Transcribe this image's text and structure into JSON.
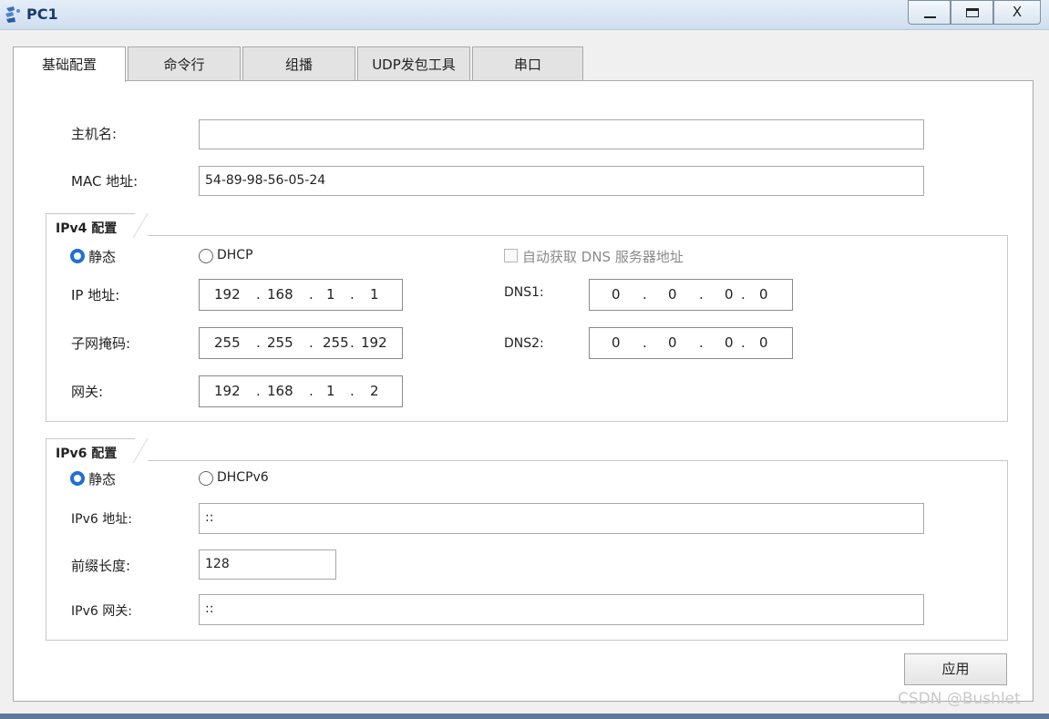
{
  "window": {
    "title": "PC1",
    "icon": "pc-app-icon",
    "controls": {
      "minimize": "minimize-icon",
      "maximize": "maximize-icon",
      "close": "X"
    }
  },
  "tabs": [
    {
      "label": "基础配置",
      "active": true
    },
    {
      "label": "命令行",
      "active": false
    },
    {
      "label": "组播",
      "active": false
    },
    {
      "label": "UDP发包工具",
      "active": false
    },
    {
      "label": "串口",
      "active": false
    }
  ],
  "basic": {
    "hostname_label": "主机名:",
    "hostname_value": "",
    "mac_label": "MAC 地址:",
    "mac_value": "54-89-98-56-05-24"
  },
  "ipv4": {
    "group_title": "IPv4 配置",
    "static_label": "静态",
    "dhcp_label": "DHCP",
    "mode": "static",
    "auto_dns_label": "自动获取 DNS 服务器地址",
    "auto_dns_checked": false,
    "ip_label": "IP 地址:",
    "ip": [
      "192",
      "168",
      "1",
      "1"
    ],
    "mask_label": "子网掩码:",
    "mask": [
      "255",
      "255",
      "255",
      "192"
    ],
    "gateway_label": "网关:",
    "gateway": [
      "192",
      "168",
      "1",
      "2"
    ],
    "dns1_label": "DNS1:",
    "dns1": [
      "0",
      "0",
      "0",
      "0"
    ],
    "dns2_label": "DNS2:",
    "dns2": [
      "0",
      "0",
      "0",
      "0"
    ],
    "separator": "."
  },
  "ipv6": {
    "group_title": "IPv6 配置",
    "static_label": "静态",
    "dhcp_label": "DHCPv6",
    "mode": "static",
    "addr_label": "IPv6 地址:",
    "addr_value": "::",
    "prefix_label": "前缀长度:",
    "prefix_value": "128",
    "gateway_label": "IPv6 网关:",
    "gateway_value": "::"
  },
  "apply_label": "应用",
  "watermark": "CSDN @Bushlet",
  "colors": {
    "accent": "#1f6fd6",
    "titlebar": "#d6e4f2",
    "title_text": "#1b3a6c"
  }
}
